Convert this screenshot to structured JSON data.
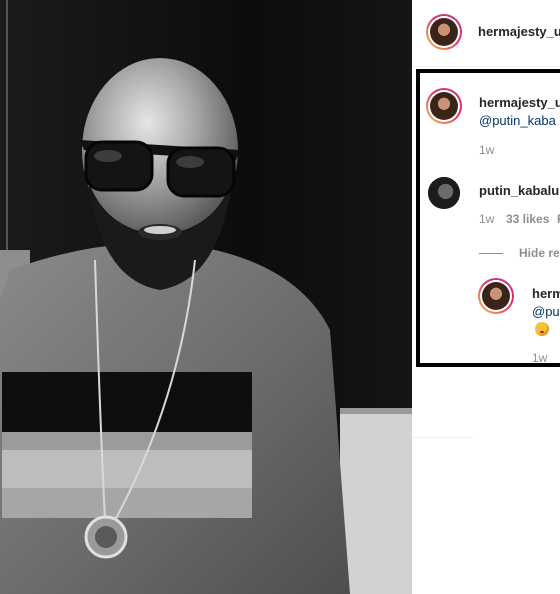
{
  "photo": {
    "description_icon": "portrait-photo"
  },
  "post_header": {
    "username": "hermajesty_u"
  },
  "comments": [
    {
      "username": "hermajesty_u",
      "mention": "@putin_kaba",
      "time": "1w"
    },
    {
      "username": "putin_kabalu",
      "time": "1w",
      "likes": "33 likes",
      "reply": "R"
    }
  ],
  "replies": {
    "toggle_label": "Hide rep",
    "items": [
      {
        "username": "herm",
        "mention": "@pu",
        "emoji": "😘",
        "time": "1w"
      }
    ]
  },
  "colors": {
    "highlight_border": "#000000",
    "link": "#00376b",
    "muted": "#8e8e8e"
  }
}
